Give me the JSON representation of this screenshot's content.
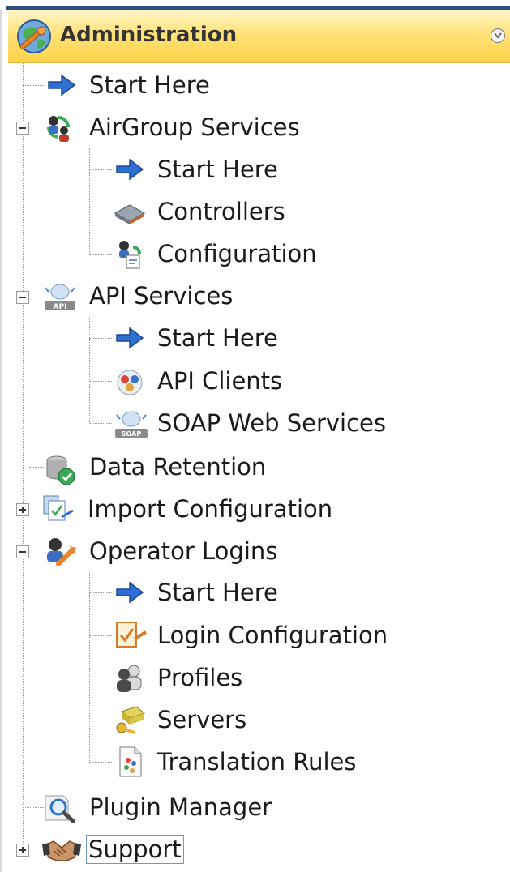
{
  "panel": {
    "title": "Administration",
    "header_icon": "administration-globe-icon",
    "collapse_icon": "chevron-down-icon"
  },
  "tree": {
    "items": [
      {
        "label": "Start Here",
        "icon": "arrow-right-icon"
      },
      {
        "label": "AirGroup Services",
        "icon": "airgroup-services-icon",
        "expander": "minus",
        "children": [
          {
            "label": "Start Here",
            "icon": "arrow-right-icon"
          },
          {
            "label": "Controllers",
            "icon": "controller-device-icon"
          },
          {
            "label": "Configuration",
            "icon": "configuration-icon"
          }
        ]
      },
      {
        "label": "API Services",
        "icon": "api-icon",
        "expander": "minus",
        "children": [
          {
            "label": "Start Here",
            "icon": "arrow-right-icon"
          },
          {
            "label": "API Clients",
            "icon": "api-clients-icon"
          },
          {
            "label": "SOAP Web Services",
            "icon": "soap-icon"
          }
        ]
      },
      {
        "label": "Data Retention",
        "icon": "data-retention-icon"
      },
      {
        "label": "Import Configuration",
        "icon": "import-configuration-icon",
        "expander": "plus"
      },
      {
        "label": "Operator Logins",
        "icon": "operator-logins-icon",
        "expander": "minus",
        "children": [
          {
            "label": "Start Here",
            "icon": "arrow-right-icon"
          },
          {
            "label": "Login Configuration",
            "icon": "login-configuration-icon"
          },
          {
            "label": "Profiles",
            "icon": "profiles-icon"
          },
          {
            "label": "Servers",
            "icon": "servers-keys-icon"
          },
          {
            "label": "Translation Rules",
            "icon": "translation-rules-icon"
          }
        ]
      },
      {
        "label": "Plugin Manager",
        "icon": "magnifier-icon"
      },
      {
        "label": "Support",
        "icon": "handshake-icon",
        "expander": "plus",
        "focused": true
      }
    ]
  },
  "colors": {
    "header_gradient_top": "#fff7c8",
    "header_gradient_bottom": "#ffd24a",
    "top_bar": "#2e4f7a",
    "focus_outline": "#6f93d6"
  }
}
